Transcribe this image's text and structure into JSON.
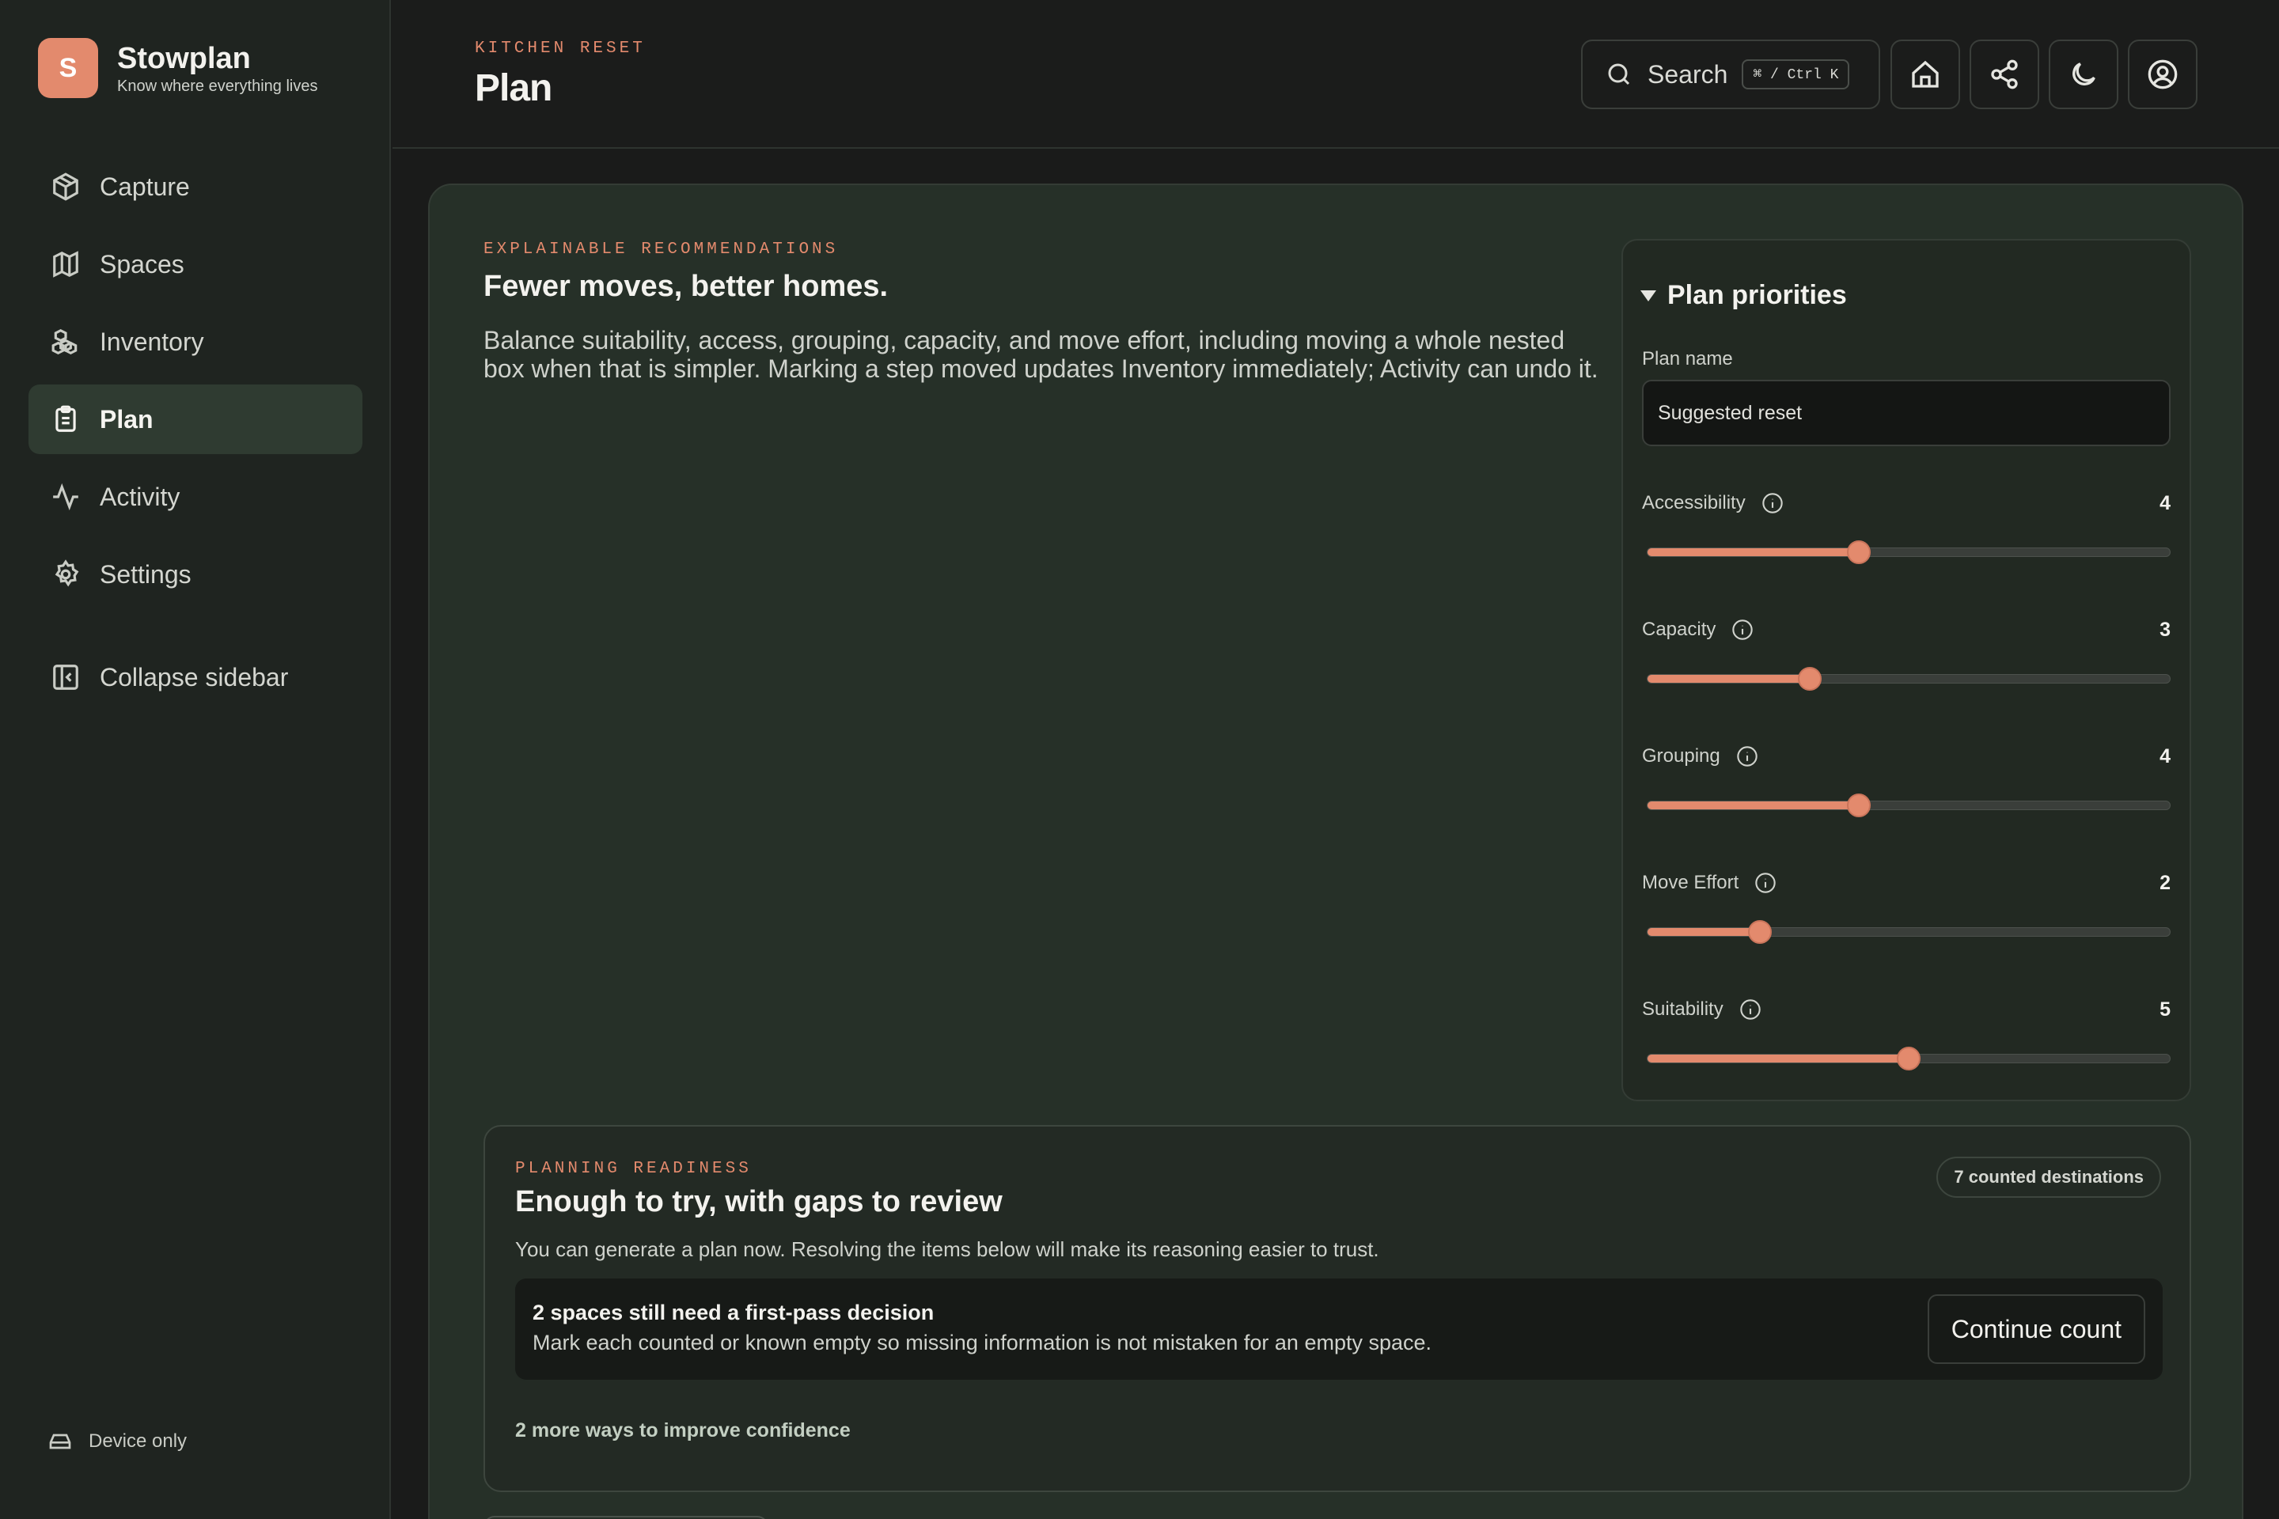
{
  "brand": {
    "logo_letter": "S",
    "name": "Stowplan",
    "tagline": "Know where everything lives",
    "accent": "#e38a6d"
  },
  "sidebar": {
    "items": [
      {
        "label": "Capture",
        "icon": "package-icon",
        "active": false
      },
      {
        "label": "Spaces",
        "icon": "map-icon",
        "active": false
      },
      {
        "label": "Inventory",
        "icon": "boxes-icon",
        "active": false
      },
      {
        "label": "Plan",
        "icon": "clipboard-list-icon",
        "active": true
      },
      {
        "label": "Activity",
        "icon": "activity-icon",
        "active": false
      },
      {
        "label": "Settings",
        "icon": "gear-icon",
        "active": false
      }
    ],
    "collapse_label": "Collapse sidebar",
    "storage_status": "Device only"
  },
  "header": {
    "eyebrow": "KITCHEN RESET",
    "title": "Plan",
    "search_label": "Search",
    "search_shortcut": "⌘ / Ctrl K"
  },
  "intro": {
    "eyebrow": "EXPLAINABLE RECOMMENDATIONS",
    "heading": "Fewer moves, better homes.",
    "body": "Balance suitability, access, grouping, capacity, and move effort, including moving a whole nested box when that is simpler. Marking a step moved updates Inventory immediately; Activity can undo it."
  },
  "priorities": {
    "title": "Plan priorities",
    "plan_name_label": "Plan name",
    "plan_name_value": "Suggested reset",
    "sliders": [
      {
        "label": "Accessibility",
        "value": "4",
        "fraction": 0.405
      },
      {
        "label": "Capacity",
        "value": "3",
        "fraction": 0.31
      },
      {
        "label": "Grouping",
        "value": "4",
        "fraction": 0.405
      },
      {
        "label": "Move Effort",
        "value": "2",
        "fraction": 0.215
      },
      {
        "label": "Suitability",
        "value": "5",
        "fraction": 0.5
      }
    ]
  },
  "readiness": {
    "eyebrow": "PLANNING READINESS",
    "heading": "Enough to try, with gaps to review",
    "subtitle": "You can generate a plan now. Resolving the items below will make its reasoning easier to trust.",
    "badge": "7 counted destinations",
    "callout_title": "2 spaces still need a first-pass decision",
    "callout_body": "Mark each counted or known empty so missing information is not mistaken for an empty space.",
    "callout_button": "Continue count",
    "more_link": "2 more ways to improve confidence"
  }
}
